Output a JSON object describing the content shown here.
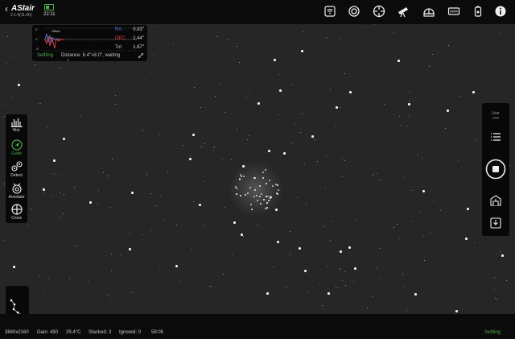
{
  "app": {
    "logo": "ASIair",
    "version": "2.1.4(11.00)",
    "clock": "22:11"
  },
  "top_icons": [
    "wifi-icon",
    "camera-icon",
    "guide-target-icon",
    "telescope-icon",
    "observatory-icon",
    "storage-icon",
    "power-icon",
    "info-icon"
  ],
  "guide": {
    "ytick_top": "8\"",
    "ytick_mid": "0\"",
    "ytick_bot": "-8\"",
    "legend": "Offset",
    "ra_label": "RA",
    "ra_value": "0.83\"",
    "dec_label": "DEC",
    "dec_value": "1.44\"",
    "tot_label": "Tot",
    "tot_value": "1.67\"",
    "status": "Settling",
    "distance": "Distance: 6.4\">3.0\", waiting",
    "ra_color": "#4a78e0",
    "dec_color": "#e04040"
  },
  "left_tools": [
    {
      "label": "Hist.",
      "icon": "histogram-icon",
      "active": false
    },
    {
      "label": "Guide",
      "icon": "guide-icon",
      "active": true
    },
    {
      "label": "Detect",
      "icon": "detect-icon",
      "active": false
    },
    {
      "label": "Annotate",
      "icon": "annotate-icon",
      "active": false
    },
    {
      "label": "Cross",
      "icon": "crosshair-icon",
      "active": false
    }
  ],
  "right_tools": {
    "mode": "Live",
    "icons": [
      "list-icon",
      "stop-icon",
      "plan-icon",
      "download-icon"
    ]
  },
  "status_bar": {
    "resolution": "3840x2160",
    "gain": "Gain: 450",
    "temperature": "29.4°C",
    "stacked": "Stacked: 3",
    "ignored": "Ignored: 0",
    "elapsed": "58:05",
    "state": "Settling"
  },
  "colors": {
    "accent_green": "#4caf50",
    "panel": "#000000",
    "sky": "#262626"
  }
}
